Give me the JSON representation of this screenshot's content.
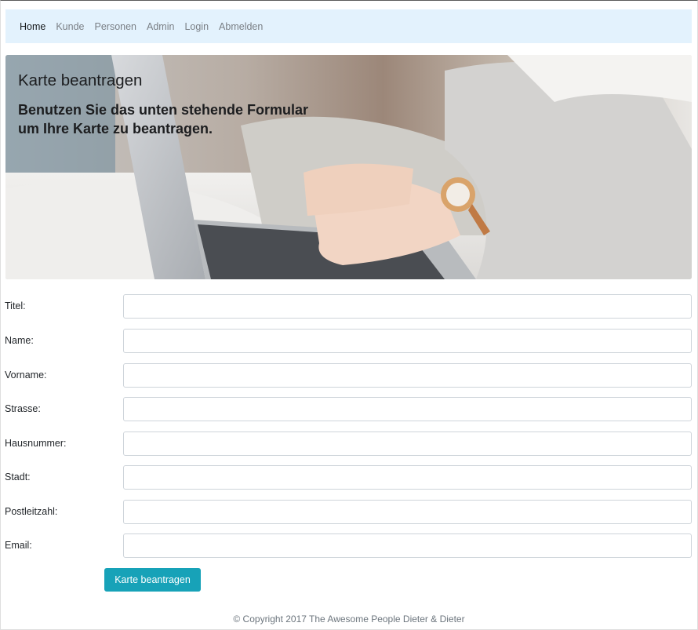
{
  "nav": {
    "items": [
      {
        "label": "Home"
      },
      {
        "label": "Kunde"
      },
      {
        "label": "Personen"
      },
      {
        "label": "Admin"
      },
      {
        "label": "Login"
      },
      {
        "label": "Abmelden"
      }
    ]
  },
  "hero": {
    "title": "Karte beantragen",
    "subtitle": "Benutzen Sie das unten stehende Formular um Ihre Karte zu beantragen."
  },
  "form": {
    "fields": [
      {
        "label": "Titel:",
        "value": ""
      },
      {
        "label": "Name:",
        "value": ""
      },
      {
        "label": "Vorname:",
        "value": ""
      },
      {
        "label": "Strasse:",
        "value": ""
      },
      {
        "label": "Hausnummer:",
        "value": ""
      },
      {
        "label": "Stadt:",
        "value": ""
      },
      {
        "label": "Postleitzahl:",
        "value": ""
      },
      {
        "label": "Email:",
        "value": ""
      }
    ],
    "submit_label": "Karte beantragen"
  },
  "footer": {
    "text": "© Copyright 2017 The Awesome People Dieter & Dieter"
  },
  "colors": {
    "navbar_bg": "#e3f2fd",
    "button_bg": "#17a2b8"
  }
}
